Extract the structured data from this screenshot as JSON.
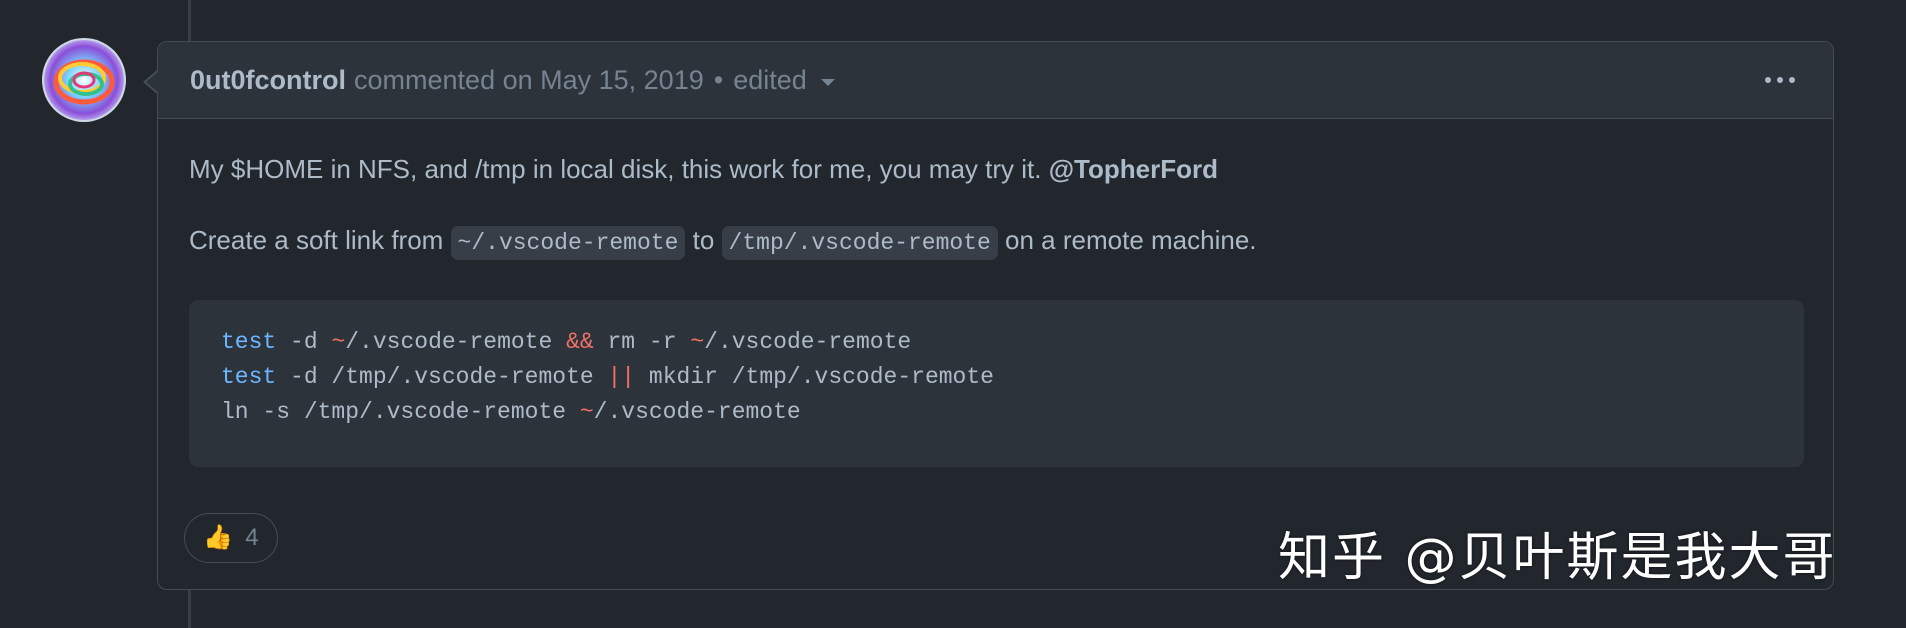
{
  "comment": {
    "author": "0ut0fcontrol",
    "action": "commented on May 15, 2019",
    "separator": "•",
    "edited_label": "edited",
    "body": {
      "paragraph1_text": "My $HOME in NFS, and /tmp in local disk, this work for me, you may try it.",
      "paragraph1_mention": "@TopherFord",
      "paragraph2_prefix": "Create a soft link from",
      "paragraph2_code1": "~/.vscode-remote",
      "paragraph2_mid": "to",
      "paragraph2_code2": "/tmp/.vscode-remote",
      "paragraph2_suffix": "on a remote machine."
    },
    "code_lines": [
      {
        "kw": "test",
        "a": " -d ",
        "op1": "~",
        "b": "/.vscode-remote ",
        "op2": "&&",
        "c": " rm -r ",
        "op3": "~",
        "d": "/.vscode-remote"
      },
      {
        "kw": "test",
        "a": " -d /tmp/.vscode-remote ",
        "op2": "||",
        "c": " mkdir /tmp/.vscode-remote"
      },
      {
        "a": "ln -s /tmp/.vscode-remote ",
        "op1": "~",
        "b": "/.vscode-remote"
      }
    ],
    "reactions": [
      {
        "icon": "thumbs-up-icon",
        "glyph": "👍",
        "count": "4"
      }
    ]
  },
  "watermark": "知乎 @贝叶斯是我大哥",
  "colors": {
    "background": "#22272e",
    "header_bg": "#2d333b",
    "border": "#444c56",
    "text": "#adbac7",
    "muted": "#768390",
    "keyword": "#6cb6ff",
    "operator": "#f47067"
  }
}
